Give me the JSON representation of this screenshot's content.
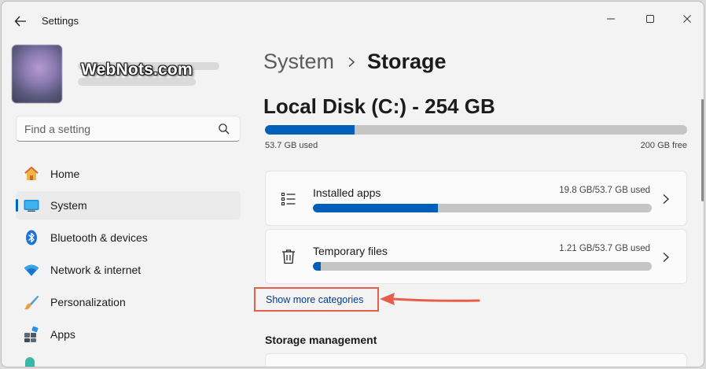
{
  "titlebar": {
    "app_title": "Settings",
    "back_icon": "back-arrow-icon",
    "minimize_icon": "minimize-icon",
    "maximize_icon": "maximize-icon",
    "close_icon": "close-icon"
  },
  "profile": {
    "watermark": "WebNots.com"
  },
  "search": {
    "placeholder": "Find a setting",
    "icon": "search-icon"
  },
  "sidebar": {
    "items": [
      {
        "label": "Home",
        "icon": "home-icon"
      },
      {
        "label": "System",
        "icon": "monitor-icon",
        "active": true
      },
      {
        "label": "Bluetooth & devices",
        "icon": "bluetooth-icon"
      },
      {
        "label": "Network & internet",
        "icon": "wifi-icon"
      },
      {
        "label": "Personalization",
        "icon": "brush-icon"
      },
      {
        "label": "Apps",
        "icon": "apps-icon"
      }
    ]
  },
  "main": {
    "breadcrumb_parent": "System",
    "breadcrumb_current": "Storage",
    "disk_title": "Local Disk (C:) - 254 GB",
    "used_label": "53.7 GB used",
    "free_label": "200 GB free",
    "disk_used_fraction": 0.212,
    "categories": [
      {
        "title": "Installed apps",
        "size": "19.8 GB/53.7 GB used",
        "fraction": 0.369,
        "icon": "list-icon"
      },
      {
        "title": "Temporary files",
        "size": "1.21 GB/53.7 GB used",
        "fraction": 0.023,
        "icon": "trash-icon"
      }
    ],
    "show_more": "Show more categories",
    "storage_management_title": "Storage management"
  },
  "colors": {
    "accent": "#005fb8",
    "annotation": "#e85c4a",
    "link": "#003e92"
  }
}
